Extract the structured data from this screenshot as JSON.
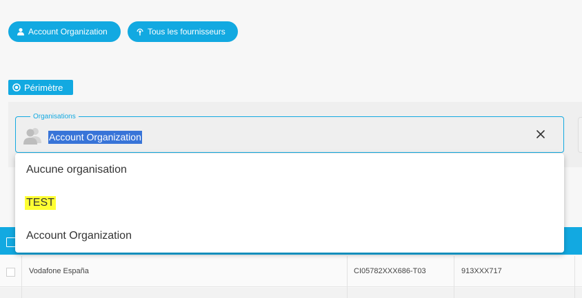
{
  "chips": {
    "organization_label": "Account Organization",
    "suppliers_label": "Tous les fournisseurs"
  },
  "perimetre": {
    "label": "Périmètre"
  },
  "organisations_field": {
    "legend": "Organisations",
    "value": "Account Organization"
  },
  "dropdown": {
    "options": [
      {
        "label": "Aucune organisation"
      },
      {
        "label": "TEST"
      },
      {
        "label": "Account Organization"
      }
    ]
  },
  "table": {
    "rows": [
      {
        "supplier": "Vodafone España",
        "contract": "CI05782XXX686-T03",
        "number": "913XXX717"
      }
    ]
  },
  "colors": {
    "accent": "#12a9e1",
    "selection": "#3874d8",
    "highlight": "#ffff33"
  }
}
